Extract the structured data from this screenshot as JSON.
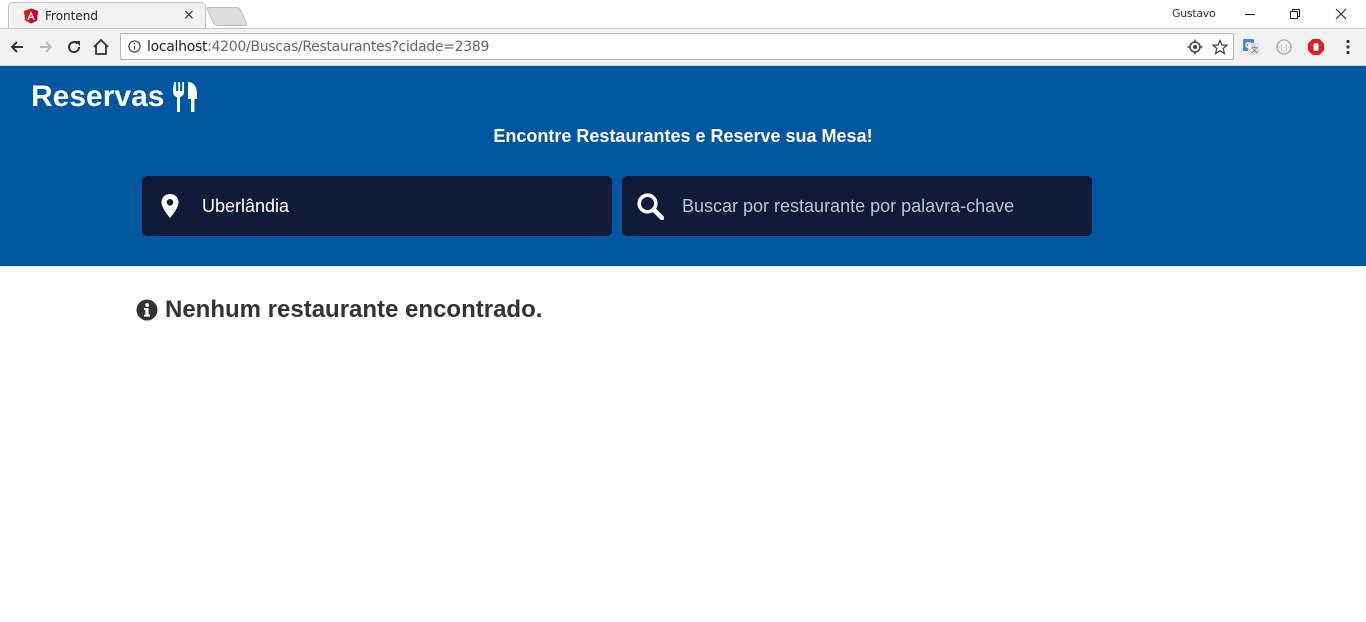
{
  "browser": {
    "tab_title": "Frontend",
    "tab_close": "×",
    "profile_name": "Gustavo",
    "url_host": "localhost",
    "url_rest": ":4200/Buscas/Restaurantes?cidade=2389"
  },
  "header": {
    "brand": "Reservas",
    "brand_icon": "utensils-icon",
    "tagline": "Encontre Restaurantes e Reserve sua Mesa!"
  },
  "search": {
    "city_value": "Uberlândia",
    "city_icon": "map-marker-icon",
    "keyword_placeholder": "Buscar por restaurante por palavra-chave",
    "keyword_icon": "search-icon"
  },
  "results": {
    "empty_message": "Nenhum restaurante encontrado.",
    "message_icon": "info-circle-icon"
  },
  "colors": {
    "header_bg": "#00579f",
    "field_bg": "#111a38",
    "message_text": "#333333"
  }
}
